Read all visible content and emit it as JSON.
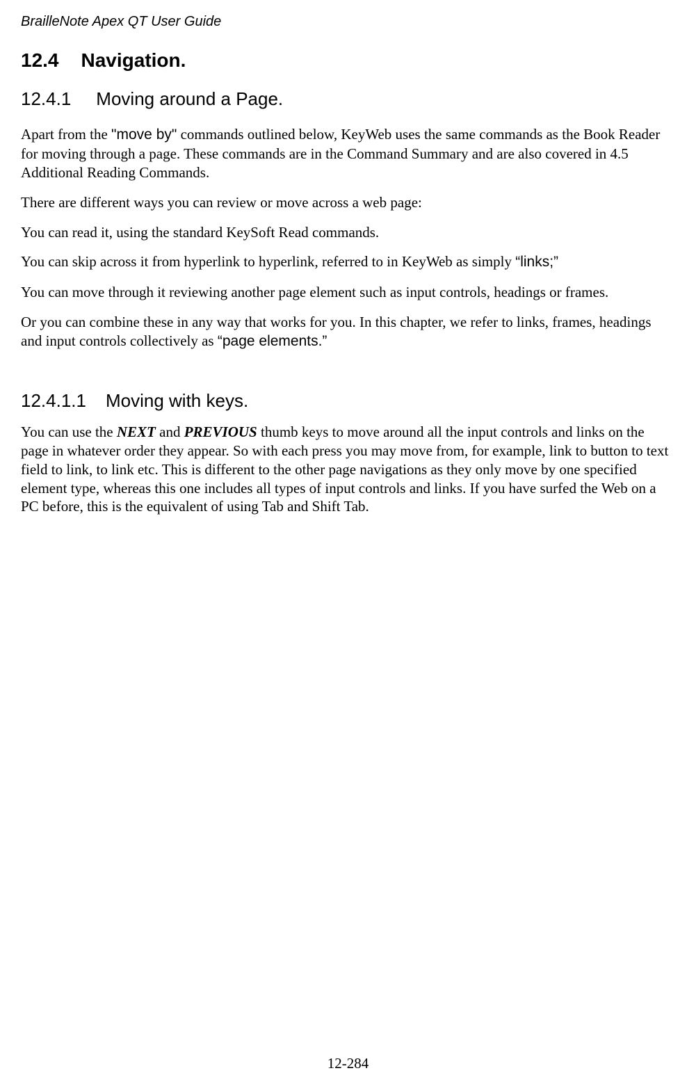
{
  "doc": {
    "running_title": "BrailleNote Apex QT User Guide",
    "page_footer": "12-284"
  },
  "headings": {
    "h1_num": "12.4",
    "h1_title": "Navigation.",
    "h2_num": "12.4.1",
    "h2_title": "Moving around a Page.",
    "h3_num": "12.4.1.1",
    "h3_title": "Moving with keys."
  },
  "body": {
    "p1_a": "Apart from the ",
    "p1_bold": "\"move by\"",
    "p1_b": " commands outlined below, KeyWeb uses the same commands as the Book Reader for moving through a page. These commands are in the Command Summary and are also covered in 4.5 Additional Reading Commands.",
    "p2": "There are different ways you can review or move across a web page:",
    "p3": "You can read it, using the standard KeySoft Read commands.",
    "p4_a": "You can skip across it from hyperlink to hyperlink, referred to in KeyWeb as simply ",
    "p4_bold": "“links;”",
    "p5": "You can move through it reviewing another page element such as input controls, headings or frames.",
    "p6_a": "Or you can combine these in any way that works for you. In this chapter, we refer to links, frames, headings and input controls collectively as ",
    "p6_bold": "“page elements.”",
    "p7_a": "You can use the ",
    "p7_next": "NEXT",
    "p7_b": " and ",
    "p7_prev": "PREVIOUS",
    "p7_c": " thumb keys to move around all the input controls and links on the page in whatever order they appear. So with each press you may move from, for example, link to button to text field to link, to link etc. This is different to the other page navigations as they only move by one specified element type, whereas this one includes all types of input controls and links. If you have surfed the Web on a PC before, this is the equivalent of using Tab and Shift Tab."
  }
}
